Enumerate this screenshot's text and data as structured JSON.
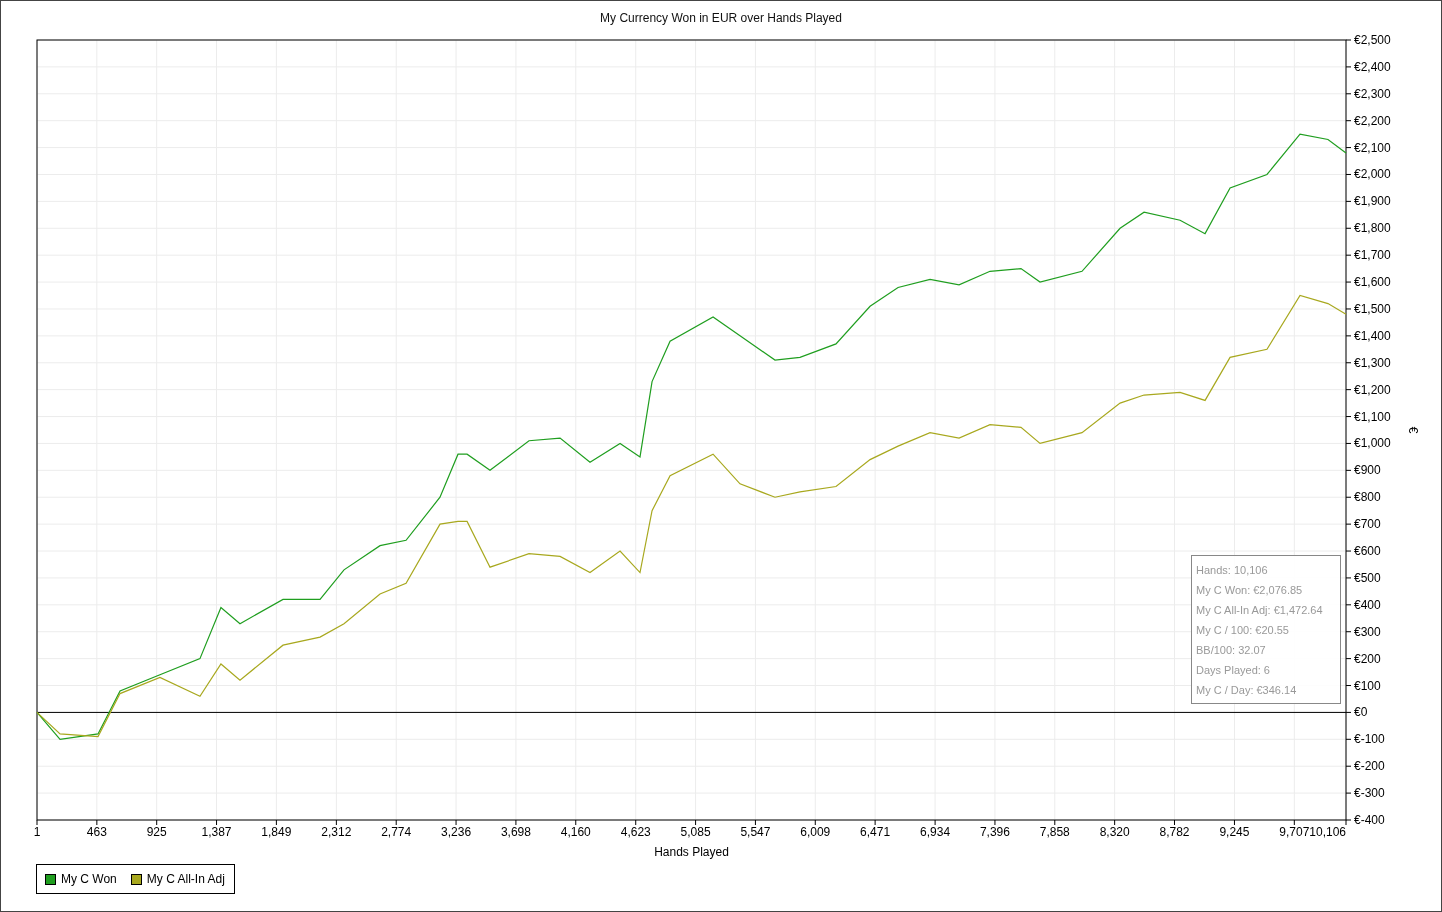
{
  "chart_data": {
    "type": "line",
    "grid": true,
    "title": "My Currency Won in EUR over Hands Played",
    "xlabel": "Hands Played",
    "ylabel": "€",
    "x": [
      1,
      179,
      472,
      642,
      950,
      1259,
      1421,
      1568,
      1900,
      2186,
      2371,
      2649,
      2850,
      3112,
      3251,
      3321,
      3498,
      3799,
      4039,
      4270,
      4502,
      4656,
      4749,
      4888,
      5220,
      5428,
      5698,
      5891,
      6169,
      6432,
      6648,
      6895,
      7119,
      7358,
      7597,
      7744,
      8068,
      8362,
      8547,
      8825,
      9018,
      9211,
      9496,
      9751,
      9967,
      10106
    ],
    "series": [
      {
        "name": "My C Won",
        "color": "#1f9e1f",
        "values": [
          0,
          -100,
          -80,
          80,
          140,
          200,
          390,
          330,
          420,
          420,
          530,
          620,
          640,
          800,
          960,
          960,
          900,
          1010,
          1020,
          930,
          1000,
          950,
          1230,
          1380,
          1470,
          1400,
          1310,
          1320,
          1370,
          1510,
          1580,
          1610,
          1590,
          1640,
          1650,
          1600,
          1640,
          1800,
          1860,
          1830,
          1780,
          1950,
          2000,
          2150,
          2130,
          2080
        ]
      },
      {
        "name": "My C All-In Adj",
        "color": "#a8a81e",
        "values": [
          0,
          -80,
          -90,
          70,
          130,
          60,
          180,
          120,
          250,
          280,
          330,
          440,
          480,
          700,
          710,
          710,
          540,
          590,
          580,
          520,
          600,
          520,
          750,
          880,
          960,
          850,
          800,
          820,
          840,
          940,
          990,
          1040,
          1020,
          1070,
          1060,
          1000,
          1040,
          1150,
          1180,
          1190,
          1160,
          1320,
          1350,
          1550,
          1520,
          1480
        ]
      }
    ],
    "xlim": [
      1,
      10106
    ],
    "ylim": [
      -400,
      2500
    ],
    "xticks": [
      {
        "value": 1,
        "label": "1"
      },
      {
        "value": 463,
        "label": "463"
      },
      {
        "value": 925,
        "label": "925"
      },
      {
        "value": 1387,
        "label": "1,387"
      },
      {
        "value": 1849,
        "label": "1,849"
      },
      {
        "value": 2312,
        "label": "2,312"
      },
      {
        "value": 2774,
        "label": "2,774"
      },
      {
        "value": 3236,
        "label": "3,236"
      },
      {
        "value": 3698,
        "label": "3,698"
      },
      {
        "value": 4160,
        "label": "4,160"
      },
      {
        "value": 4623,
        "label": "4,623"
      },
      {
        "value": 5085,
        "label": "5,085"
      },
      {
        "value": 5547,
        "label": "5,547"
      },
      {
        "value": 6009,
        "label": "6,009"
      },
      {
        "value": 6471,
        "label": "6,471"
      },
      {
        "value": 6934,
        "label": "6,934"
      },
      {
        "value": 7396,
        "label": "7,396"
      },
      {
        "value": 7858,
        "label": "7,858"
      },
      {
        "value": 8320,
        "label": "8,320"
      },
      {
        "value": 8782,
        "label": "8,782"
      },
      {
        "value": 9245,
        "label": "9,245"
      },
      {
        "value": 9707,
        "label": "9,707"
      },
      {
        "value": 10106,
        "label": "10,106"
      }
    ],
    "yticks": [
      {
        "value": 2500,
        "label": "€2,500"
      },
      {
        "value": 2400,
        "label": "€2,400"
      },
      {
        "value": 2300,
        "label": "€2,300"
      },
      {
        "value": 2200,
        "label": "€2,200"
      },
      {
        "value": 2100,
        "label": "€2,100"
      },
      {
        "value": 2000,
        "label": "€2,000"
      },
      {
        "value": 1900,
        "label": "€1,900"
      },
      {
        "value": 1800,
        "label": "€1,800"
      },
      {
        "value": 1700,
        "label": "€1,700"
      },
      {
        "value": 1600,
        "label": "€1,600"
      },
      {
        "value": 1500,
        "label": "€1,500"
      },
      {
        "value": 1400,
        "label": "€1,400"
      },
      {
        "value": 1300,
        "label": "€1,300"
      },
      {
        "value": 1200,
        "label": "€1,200"
      },
      {
        "value": 1100,
        "label": "€1,100"
      },
      {
        "value": 1000,
        "label": "€1,000"
      },
      {
        "value": 900,
        "label": "€900"
      },
      {
        "value": 800,
        "label": "€800"
      },
      {
        "value": 700,
        "label": "€700"
      },
      {
        "value": 600,
        "label": "€600"
      },
      {
        "value": 500,
        "label": "€500"
      },
      {
        "value": 400,
        "label": "€400"
      },
      {
        "value": 300,
        "label": "€300"
      },
      {
        "value": 200,
        "label": "€200"
      },
      {
        "value": 100,
        "label": "€100"
      },
      {
        "value": 0,
        "label": "€0"
      },
      {
        "value": -100,
        "label": "€-100"
      },
      {
        "value": -200,
        "label": "€-200"
      },
      {
        "value": -300,
        "label": "€-300"
      },
      {
        "value": -400,
        "label": "€-400"
      }
    ],
    "annotations": [
      "Hands: 10,106",
      "My C Won: €2,076.85",
      "My C All-In Adj: €1,472.64",
      "My C / 100: €20.55",
      "BB/100: 32.07",
      "Days Played: 6",
      "My C / Day: €346.14"
    ]
  }
}
